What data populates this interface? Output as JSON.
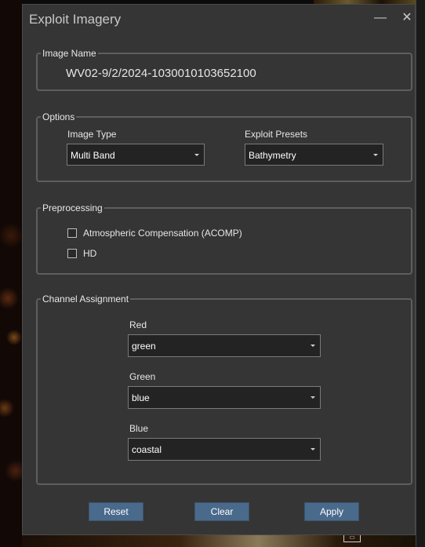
{
  "dialog": {
    "title": "Exploit Imagery",
    "minimize_glyph": "—",
    "close_glyph": "✕"
  },
  "image_name": {
    "legend": "Image Name",
    "value": "WV02-9/2/2024-1030010103652100"
  },
  "options": {
    "legend": "Options",
    "image_type": {
      "label": "Image Type",
      "selected": "Multi Band"
    },
    "exploit_presets": {
      "label": "Exploit Presets",
      "selected": "Bathymetry"
    }
  },
  "preprocessing": {
    "legend": "Preprocessing",
    "items": [
      {
        "label": "Atmospheric Compensation (ACOMP)",
        "checked": false
      },
      {
        "label": "HD",
        "checked": false
      }
    ]
  },
  "channel_assignment": {
    "legend": "Channel Assignment",
    "channels": [
      {
        "label": "Red",
        "selected": "green"
      },
      {
        "label": "Green",
        "selected": "blue"
      },
      {
        "label": "Blue",
        "selected": "coastal"
      }
    ]
  },
  "buttons": {
    "reset": "Reset",
    "clear": "Clear",
    "apply": "Apply",
    "color": "#4a6a8c"
  },
  "icons": {
    "minimize": "minimize-icon",
    "close": "close-icon",
    "dropdown": "chevron-down-icon"
  }
}
